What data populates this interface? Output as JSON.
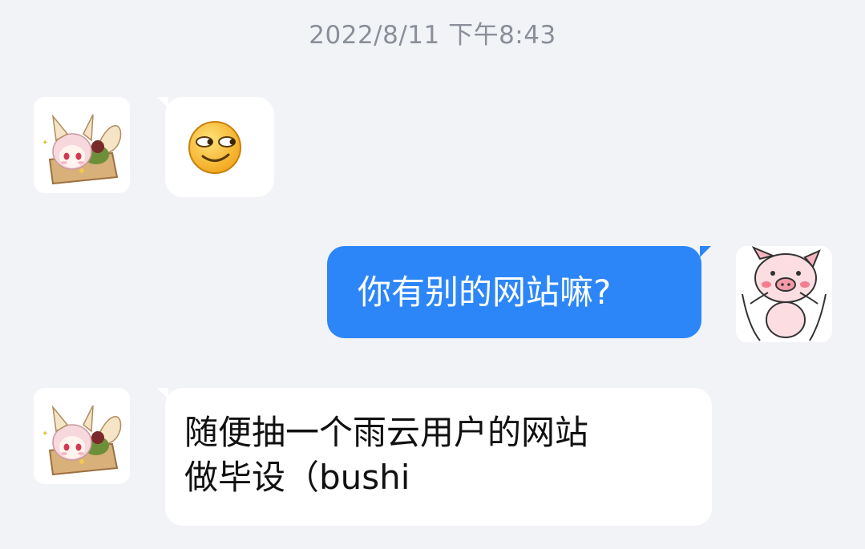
{
  "chat": {
    "timestamp": "2022/8/11 下午8:43",
    "colors": {
      "background": "#F2F3F7",
      "incoming_bubble": "#FFFFFF",
      "outgoing_bubble": "#2D86F8"
    },
    "messages": [
      {
        "sender": "other",
        "type": "emoji",
        "emoji_name": "side-eye-emoji-icon"
      },
      {
        "sender": "self",
        "type": "text",
        "text": "你有别的网站嘛?"
      },
      {
        "sender": "other",
        "type": "text",
        "text": "随便抽一个雨云用户的网站\n做毕设（bushi"
      }
    ],
    "avatars": {
      "other": "fox-girl-avatar-icon",
      "self": "pig-avatar-icon"
    }
  }
}
